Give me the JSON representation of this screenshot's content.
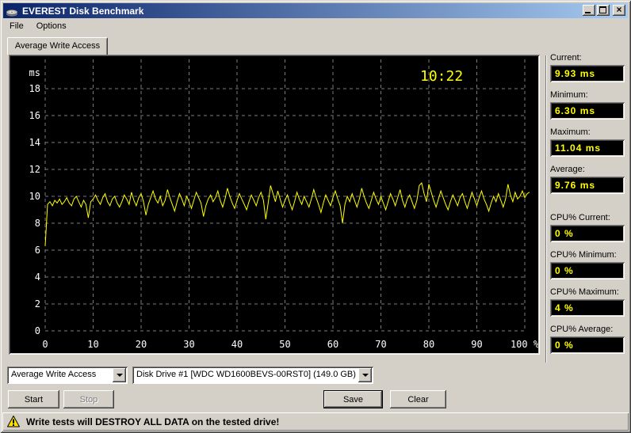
{
  "window": {
    "title": "EVEREST Disk Benchmark"
  },
  "menu": {
    "items": [
      "File",
      "Options"
    ]
  },
  "tabs": [
    {
      "label": "Average Write Access",
      "active": true
    }
  ],
  "chart_data": {
    "type": "line",
    "title": "Average Write Access",
    "unit_label": "ms",
    "clock_label": "10:22",
    "xlabel": "%",
    "ylabel": "ms",
    "xlim": [
      0,
      103
    ],
    "ylim": [
      0,
      20
    ],
    "grid": true,
    "bg_color": "#000000",
    "grid_color": "#7b7b7b",
    "axis_color": "#ffffff",
    "line_color": "#ffff00",
    "x_tick_values": [
      0,
      10,
      20,
      30,
      40,
      50,
      60,
      70,
      80,
      90,
      100
    ],
    "x_ticks": [
      "0",
      "10",
      "20",
      "30",
      "40",
      "50",
      "60",
      "70",
      "80",
      "90",
      "100 %"
    ],
    "y_ticks": [
      0,
      2,
      4,
      6,
      8,
      10,
      12,
      14,
      16,
      18
    ],
    "points_x_step": 0.5,
    "values_ms": [
      6.3,
      9.4,
      9.6,
      9.3,
      9.7,
      9.5,
      9.8,
      9.4,
      9.6,
      9.9,
      9.5,
      9.3,
      9.8,
      10.0,
      9.6,
      9.2,
      9.7,
      9.4,
      8.4,
      9.6,
      9.8,
      10.1,
      9.7,
      9.4,
      9.9,
      10.2,
      9.6,
      9.3,
      9.8,
      10.0,
      9.5,
      9.2,
      9.6,
      10.1,
      9.8,
      9.4,
      10.3,
      9.7,
      9.3,
      9.9,
      10.2,
      9.6,
      8.6,
      9.4,
      9.9,
      10.4,
      9.8,
      9.5,
      10.0,
      9.3,
      9.7,
      10.5,
      9.9,
      9.4,
      8.9,
      9.6,
      10.2,
      9.8,
      9.3,
      10.0,
      9.6,
      9.1,
      9.7,
      10.3,
      9.9,
      9.5,
      8.5,
      9.3,
      9.8,
      10.1,
      9.6,
      9.9,
      10.4,
      9.7,
      9.2,
      9.8,
      10.6,
      10.0,
      9.5,
      9.1,
      9.7,
      10.2,
      9.8,
      9.4,
      9.0,
      9.6,
      10.1,
      9.7,
      9.3,
      9.9,
      10.3,
      9.7,
      8.3,
      9.5,
      10.8,
      10.2,
      9.6,
      10.4,
      9.8,
      9.2,
      9.7,
      10.1,
      9.5,
      9.0,
      9.6,
      10.3,
      9.8,
      9.4,
      10.0,
      9.6,
      9.2,
      9.8,
      10.5,
      9.9,
      9.4,
      8.8,
      9.5,
      10.1,
      9.7,
      9.3,
      9.9,
      10.4,
      9.8,
      9.3,
      8.0,
      9.4,
      10.0,
      9.6,
      10.2,
      9.7,
      9.2,
      9.8,
      10.6,
      10.0,
      9.5,
      9.1,
      9.7,
      10.3,
      9.8,
      9.4,
      10.0,
      9.5,
      9.0,
      9.6,
      10.2,
      9.8,
      9.3,
      9.9,
      10.5,
      9.7,
      9.2,
      9.8,
      10.1,
      9.6,
      9.1,
      9.7,
      10.8,
      11.0,
      10.2,
      9.6,
      10.9,
      10.3,
      9.7,
      9.2,
      9.8,
      10.4,
      9.9,
      9.4,
      9.0,
      9.6,
      10.1,
      9.7,
      9.3,
      9.9,
      10.2,
      9.6,
      9.1,
      9.7,
      10.3,
      9.8,
      9.3,
      9.9,
      10.4,
      9.8,
      9.4,
      8.9,
      9.5,
      10.0,
      9.6,
      10.2,
      9.7,
      9.2,
      9.8,
      10.9,
      10.1,
      9.6,
      10.3,
      9.8,
      10.0,
      10.4,
      9.9,
      10.2,
      10.3
    ]
  },
  "stats": [
    {
      "label": "Current:",
      "value": "9.93 ms"
    },
    {
      "label": "Minimum:",
      "value": "6.30 ms"
    },
    {
      "label": "Maximum:",
      "value": "11.04 ms"
    },
    {
      "label": "Average:",
      "value": "9.76 ms"
    },
    {
      "label": "CPU% Current:",
      "value": "0 %"
    },
    {
      "label": "CPU% Minimum:",
      "value": "0 %"
    },
    {
      "label": "CPU% Maximum:",
      "value": "4 %"
    },
    {
      "label": "CPU% Average:",
      "value": "0 %"
    }
  ],
  "controls": {
    "test_select": {
      "value": "Average Write Access"
    },
    "drive_select": {
      "value": "Disk Drive #1  [WDC WD1600BEVS-00RST0]  (149.0 GB)"
    },
    "buttons": {
      "start": "Start",
      "stop": "Stop",
      "save": "Save",
      "clear": "Clear"
    }
  },
  "status_bar": {
    "text": "Write tests will DESTROY ALL DATA on the tested drive!"
  },
  "colors": {
    "accent": "#ffff00",
    "titlebar_start": "#0a246a",
    "titlebar_end": "#a6caf0",
    "face": "#d4d0c8"
  }
}
